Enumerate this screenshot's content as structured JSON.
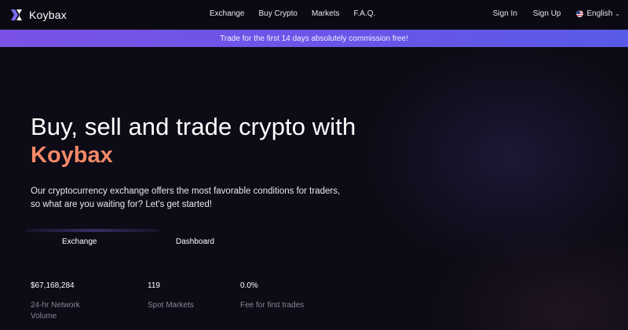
{
  "brand": {
    "name": "Koybax",
    "logo_icon": "koybax-x-logo-icon",
    "accent_color": "#f48967",
    "logo_colors": [
      "#7a6df0",
      "#ffffff"
    ]
  },
  "nav": {
    "links": [
      "Exchange",
      "Buy Crypto",
      "Markets",
      "F.A.Q."
    ],
    "sign_in": "Sign In",
    "sign_up": "Sign Up",
    "language": "English",
    "language_icon": "us-flag-icon",
    "dropdown_icon": "chevron-down-icon"
  },
  "promo": {
    "text": "Trade for the first 14 days absolutely commission free!",
    "gradient": [
      "#7a52e6",
      "#5a5ae8"
    ]
  },
  "hero": {
    "title": "Buy, sell and trade crypto with",
    "brand_word": "Koybax",
    "description_lines": [
      "Our cryptocurrency exchange offers the most favorable conditions for traders,",
      "so what are you waiting for? Let's get started!"
    ]
  },
  "buttons": {
    "exchange": "Exchange",
    "dashboard": "Dashboard"
  },
  "stats": [
    {
      "value": "$67,168,284",
      "label_lines": [
        "24-hr Network",
        "Volume"
      ]
    },
    {
      "value": "119",
      "label_lines": [
        "Spot Markets"
      ]
    },
    {
      "value": "0.0%",
      "label_lines": [
        "Fee for first trades"
      ]
    }
  ]
}
